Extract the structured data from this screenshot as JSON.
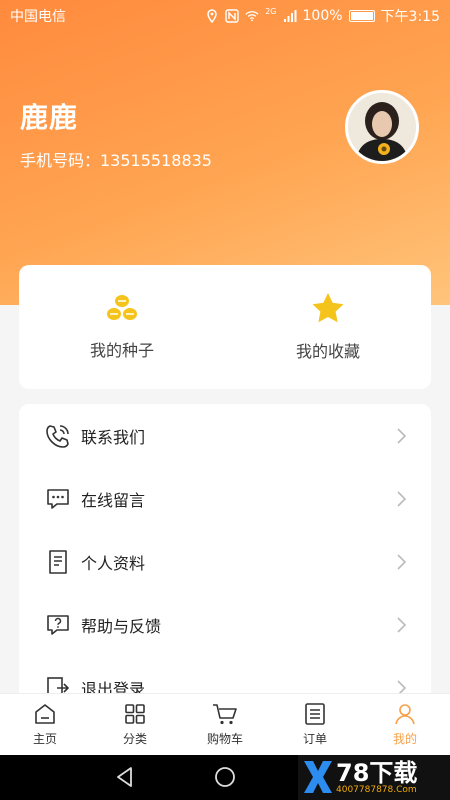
{
  "status_bar": {
    "carrier": "中国电信",
    "battery": "100%",
    "time": "下午3:15",
    "network": "2G"
  },
  "profile": {
    "name": "鹿鹿",
    "phone": "手机号码：13515518835"
  },
  "quick_actions": [
    {
      "label": "我的种子",
      "icon": "seeds-icon"
    },
    {
      "label": "我的收藏",
      "icon": "star-icon"
    }
  ],
  "menu": [
    {
      "label": "联系我们",
      "icon": "phone-icon"
    },
    {
      "label": "在线留言",
      "icon": "message-icon"
    },
    {
      "label": "个人资料",
      "icon": "document-icon"
    },
    {
      "label": "帮助与反馈",
      "icon": "help-icon"
    },
    {
      "label": "退出登录",
      "icon": "logout-icon"
    }
  ],
  "tabs": [
    {
      "label": "主页",
      "icon": "home-icon"
    },
    {
      "label": "分类",
      "icon": "grid-icon"
    },
    {
      "label": "购物车",
      "icon": "cart-icon"
    },
    {
      "label": "订单",
      "icon": "order-icon"
    },
    {
      "label": "我的",
      "icon": "user-icon",
      "active": true
    }
  ],
  "watermark": {
    "main": "78下载",
    "sub": "4007787878.Com"
  },
  "colors": {
    "accent": "#f7a14a",
    "header_start": "#ff8a3d",
    "header_end": "#ffc47a"
  }
}
